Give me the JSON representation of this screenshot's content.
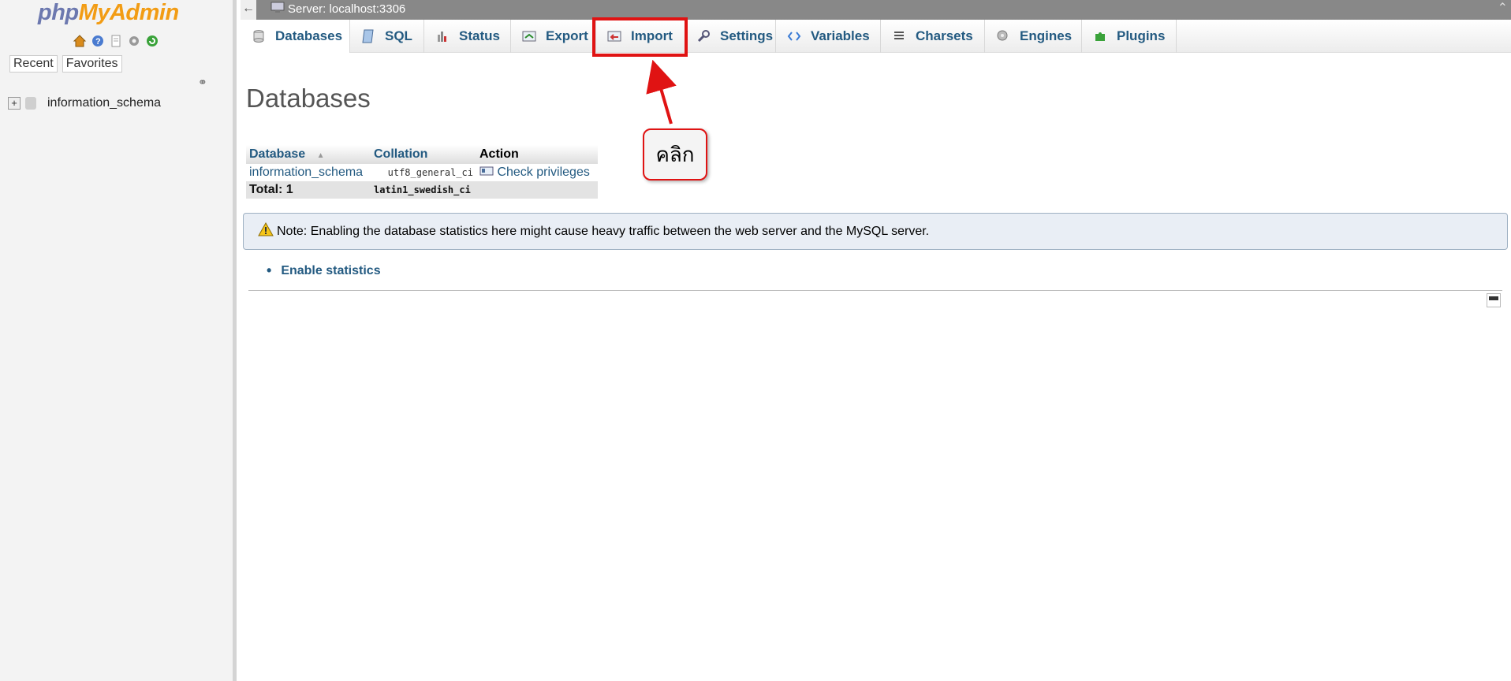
{
  "nav": {
    "logo_part1": "php",
    "logo_part2": "MyAdmin",
    "tab_recent": "Recent",
    "tab_favorites": "Favorites",
    "tree_item": "information_schema"
  },
  "topbar": {
    "back_label": "←",
    "server_label": "Server: localhost:3306"
  },
  "menu": {
    "tabs": [
      {
        "label": "Databases",
        "icon": "database-icon"
      },
      {
        "label": "SQL",
        "icon": "sql-icon"
      },
      {
        "label": "Status",
        "icon": "status-icon"
      },
      {
        "label": "Export",
        "icon": "export-icon"
      },
      {
        "label": "Import",
        "icon": "import-icon"
      },
      {
        "label": "Settings",
        "icon": "wrench-icon"
      },
      {
        "label": "Variables",
        "icon": "variables-icon"
      },
      {
        "label": "Charsets",
        "icon": "charsets-icon"
      },
      {
        "label": "Engines",
        "icon": "engines-icon"
      },
      {
        "label": "Plugins",
        "icon": "puzzle-icon"
      }
    ],
    "active": "Databases"
  },
  "main": {
    "title": "Databases",
    "table": {
      "col_database": "Database",
      "col_collation": "Collation",
      "col_action": "Action",
      "rows": [
        {
          "database": "information_schema",
          "collation": "utf8_general_ci",
          "action": "Check privileges"
        }
      ],
      "total_label": "Total: 1",
      "total_collation": "latin1_swedish_ci"
    },
    "note": "Note: Enabling the database statistics here might cause heavy traffic between the web server and the MySQL server.",
    "enable_stats": "Enable statistics"
  },
  "annotation": {
    "callout_text": "คลิก",
    "color": "#e01313"
  }
}
